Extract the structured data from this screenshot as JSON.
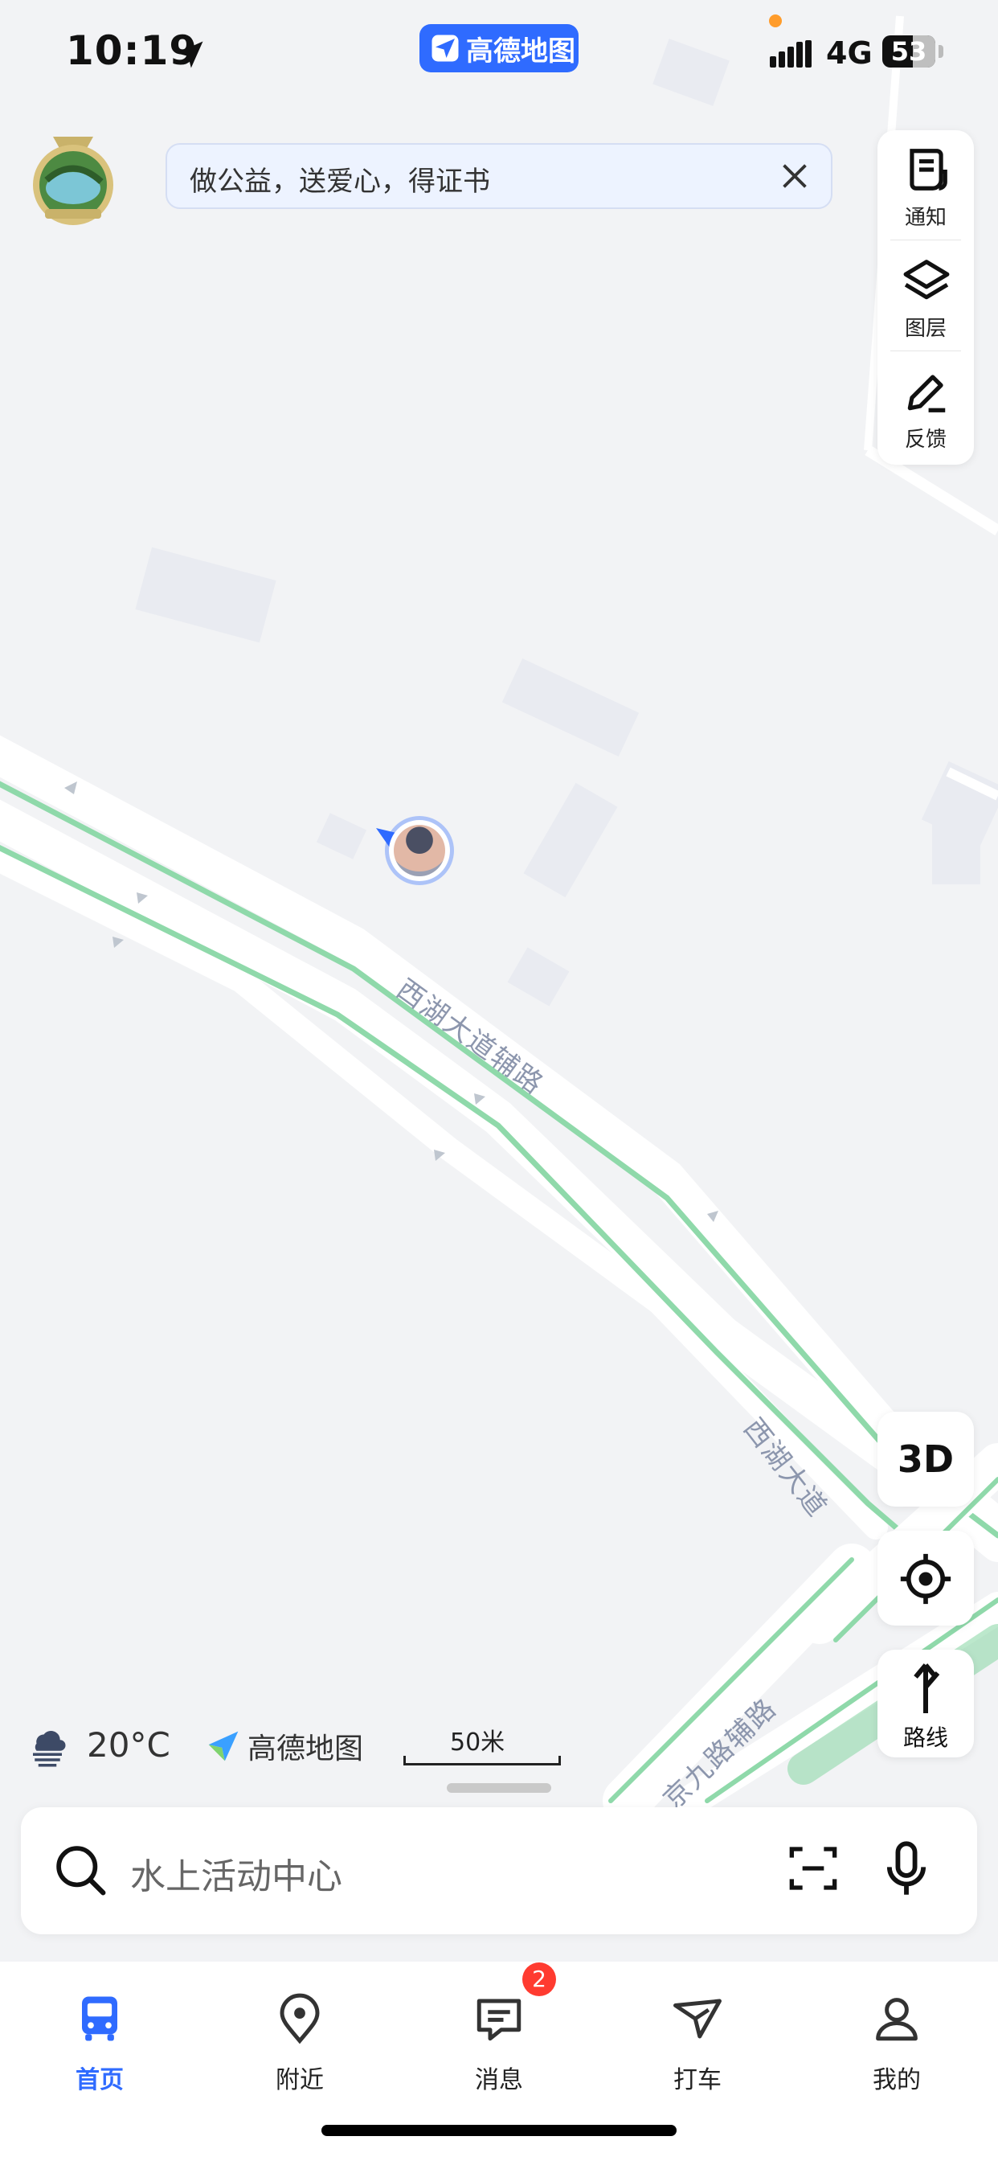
{
  "status_bar": {
    "time": "10:19",
    "app_name": "高德地图",
    "network": "4G",
    "battery": "53"
  },
  "banner": {
    "text": "做公益，送爱心，得证书"
  },
  "tool_panel": {
    "items": [
      {
        "label": "通知",
        "icon": "notification-icon"
      },
      {
        "label": "图层",
        "icon": "layers-icon"
      },
      {
        "label": "反馈",
        "icon": "feedback-pencil-icon"
      }
    ]
  },
  "map": {
    "road_labels": [
      "西湖大道辅路",
      "西湖大道",
      "京九路辅路"
    ],
    "btn_3d": "3D",
    "route_label": "路线",
    "weather": {
      "temp": "20°C",
      "icon": "fog-weather-icon"
    },
    "logo_text": "高德地图",
    "scale": "50米"
  },
  "search": {
    "placeholder": "水上活动中心"
  },
  "bottom_nav": {
    "items": [
      {
        "label": "首页",
        "icon": "bus-icon",
        "active": true
      },
      {
        "label": "附近",
        "icon": "location-pin-icon",
        "active": false
      },
      {
        "label": "消息",
        "icon": "message-icon",
        "active": false
      },
      {
        "label": "打车",
        "icon": "taxi-icon",
        "active": false
      },
      {
        "label": "我的",
        "icon": "profile-icon",
        "active": false
      }
    ],
    "message_badge": "2"
  },
  "colors": {
    "accent": "#2f6bff",
    "road_green": "#8fd9aa",
    "badge_red": "#ff3b30"
  }
}
